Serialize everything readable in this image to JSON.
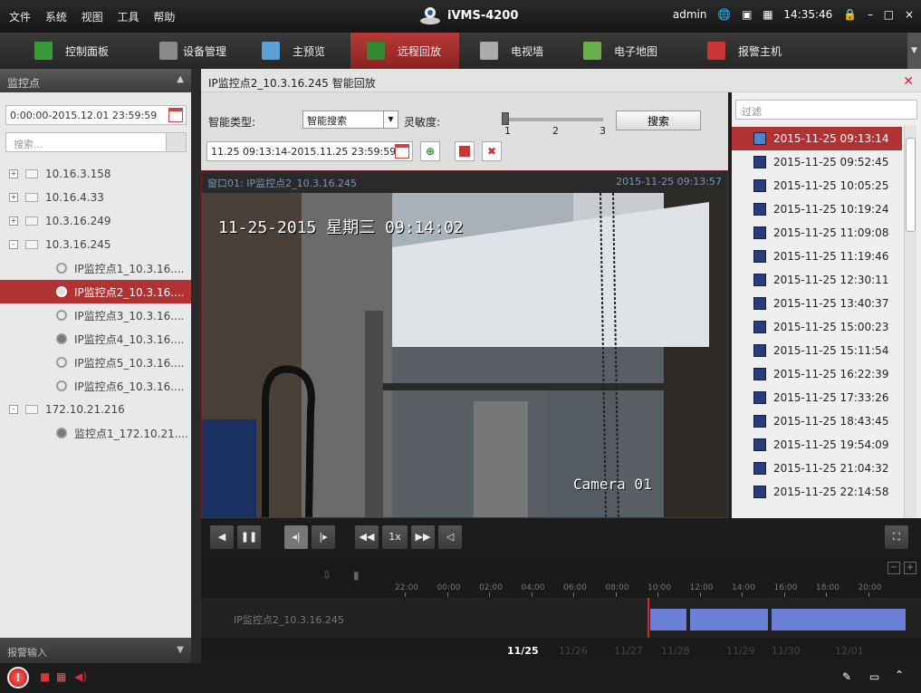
{
  "menu": [
    "文件",
    "系统",
    "视图",
    "工具",
    "帮助"
  ],
  "app_title": "iVMS-4200",
  "top_right": {
    "user": "admin",
    "time": "14:35:46"
  },
  "nav": [
    {
      "label": "控制面板",
      "color": "#3a9a3a"
    },
    {
      "label": "设备管理",
      "color": "#8a8a8a"
    },
    {
      "label": "主预览",
      "color": "#5aa0d8"
    },
    {
      "label": "远程回放",
      "color": "#2f8a2f",
      "active": true
    },
    {
      "label": "电视墙",
      "color": "#aaaaaa"
    },
    {
      "label": "电子地图",
      "color": "#6ab04c"
    },
    {
      "label": "报警主机",
      "color": "#c33"
    }
  ],
  "left": {
    "title": "监控点",
    "date_range": "0:00:00-2015.12.01 23:59:59",
    "search_placeholder": "搜索...",
    "tree": [
      {
        "label": "10.16.3.158",
        "type": "group",
        "sign": "+"
      },
      {
        "label": "10.16.4.33",
        "type": "group",
        "sign": "+"
      },
      {
        "label": "10.3.16.249",
        "type": "group",
        "sign": "+"
      },
      {
        "label": "10.3.16.245",
        "type": "group",
        "sign": "-"
      },
      {
        "label": "IP监控点1_10.3.16....",
        "type": "cam"
      },
      {
        "label": "IP监控点2_10.3.16....",
        "type": "cam",
        "selected": true
      },
      {
        "label": "IP监控点3_10.3.16....",
        "type": "cam"
      },
      {
        "label": "IP监控点4_10.3.16....",
        "type": "cam",
        "dark": true
      },
      {
        "label": "IP监控点5_10.3.16....",
        "type": "cam"
      },
      {
        "label": "IP监控点6_10.3.16....",
        "type": "cam"
      },
      {
        "label": "172.10.21.216",
        "type": "group",
        "sign": "-"
      },
      {
        "label": "监控点1_172.10.21....",
        "type": "cam",
        "dark": true
      }
    ],
    "alarm_input": "报警输入"
  },
  "center": {
    "title": "IP监控点2_10.3.16.245 智能回放",
    "smart_type_label": "智能类型:",
    "smart_type_value": "智能搜索",
    "sensitivity_label": "灵敏度:",
    "slider_ticks": [
      "1",
      "2",
      "3"
    ],
    "search_button": "搜索",
    "time_range": "11.25 09:13:14-2015.11.25 23:59:59",
    "window_label": "窗口01: IP监控点2_10.3.16.245",
    "window_time": "2015-11-25 09:13:57",
    "osd_time": "11-25-2015 星期三 09:14:02",
    "osd_camera": "Camera 01",
    "speed": "1x"
  },
  "right": {
    "filter_placeholder": "过滤",
    "items": [
      "2015-11-25 09:13:14",
      "2015-11-25 09:52:45",
      "2015-11-25 10:05:25",
      "2015-11-25 10:19:24",
      "2015-11-25 11:09:08",
      "2015-11-25 11:19:46",
      "2015-11-25 12:30:11",
      "2015-11-25 13:40:37",
      "2015-11-25 15:00:23",
      "2015-11-25 15:11:54",
      "2015-11-25 16:22:39",
      "2015-11-25 17:33:26",
      "2015-11-25 18:43:45",
      "2015-11-25 19:54:09",
      "2015-11-25 21:04:32",
      "2015-11-25 22:14:58"
    ]
  },
  "timeline": {
    "hours": [
      "22:00",
      "00:00",
      "02:00",
      "04:00",
      "06:00",
      "08:00",
      "10:00",
      "12:00",
      "14:00",
      "16:00",
      "18:00",
      "20:00"
    ],
    "track_label": "IP监控点2_10.3.16.245",
    "dates": [
      "11/25",
      "11/26",
      "11/27",
      "11/28",
      "11/29",
      "11/30",
      "12/01"
    ]
  }
}
